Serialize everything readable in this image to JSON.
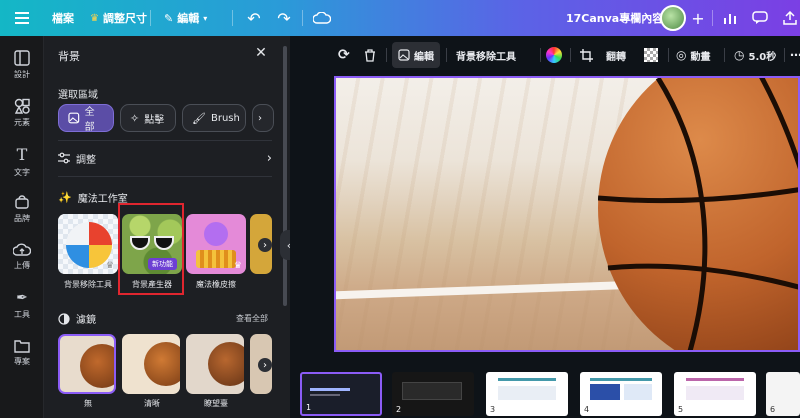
{
  "topbar": {
    "menu_icon": "hamburger-icon",
    "file_label": "檔案",
    "resize_label": "調整尺寸",
    "edit_label": "編輯",
    "project_title": "17Canva專欄內容"
  },
  "rail": {
    "items": [
      {
        "label": "設計",
        "icon": "layout-icon"
      },
      {
        "label": "元素",
        "icon": "shapes-icon"
      },
      {
        "label": "文字",
        "icon": "text-icon"
      },
      {
        "label": "品牌",
        "icon": "brand-icon"
      },
      {
        "label": "上傳",
        "icon": "upload-icon"
      },
      {
        "label": "工具",
        "icon": "pen-icon"
      },
      {
        "label": "專案",
        "icon": "folder-icon"
      }
    ]
  },
  "panel": {
    "title": "背景",
    "select_area_label": "選取區域",
    "chips": [
      {
        "label": "全部",
        "active": true
      },
      {
        "label": "點擊",
        "active": false
      },
      {
        "label": "Brush",
        "active": false
      }
    ],
    "adjust_label": "調整",
    "magic_studio_label": "魔法工作室",
    "magic_items": [
      {
        "label": "背景移除工具"
      },
      {
        "label": "背景產生器",
        "badge": "新功能"
      },
      {
        "label": "魔法橡皮擦"
      }
    ],
    "filters_label": "濾鏡",
    "see_all_label": "查看全部",
    "filters": [
      {
        "label": "無"
      },
      {
        "label": "清晰"
      },
      {
        "label": "瞭望臺"
      }
    ]
  },
  "canvas_toolbar": {
    "edit_label": "編輯",
    "bg_remover_label": "背景移除工具",
    "flip_label": "翻轉",
    "animate_label": "動畫",
    "duration_label": "5.0秒"
  },
  "pages": [
    "1",
    "2",
    "3",
    "4",
    "5",
    "6"
  ],
  "colors": {
    "accent": "#8b5cf6",
    "highlight": "#e0262f",
    "panel_bg": "#1d1f23"
  }
}
